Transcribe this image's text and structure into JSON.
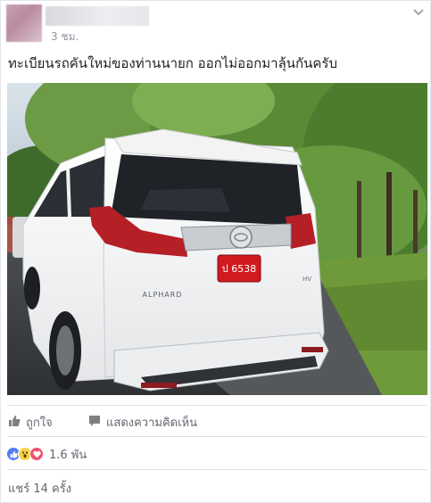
{
  "post": {
    "timestamp": "3 ชม.",
    "text": "ทะเบียนรถคันใหม่ของท่านนายก ออกไม่ออกมาลุ้นกันครับ"
  },
  "photo": {
    "plate_text": "ป 6538",
    "badge_text": "ALPHARD"
  },
  "actions": {
    "like_label": "ถูกใจ",
    "comment_label": "แสดงความคิดเห็น"
  },
  "reactions": {
    "count": "1.6 พัน",
    "types": [
      "like-icon",
      "wow-icon",
      "love-icon"
    ]
  },
  "shares": {
    "text": "แชร์ 14 ครั้ง"
  },
  "colors": {
    "text": "#1d2129",
    "meta": "#90949c",
    "action": "#616770",
    "like_blue": "#4f7df5",
    "love_red": "#f0526e",
    "wow_yellow": "#f7d24a"
  }
}
